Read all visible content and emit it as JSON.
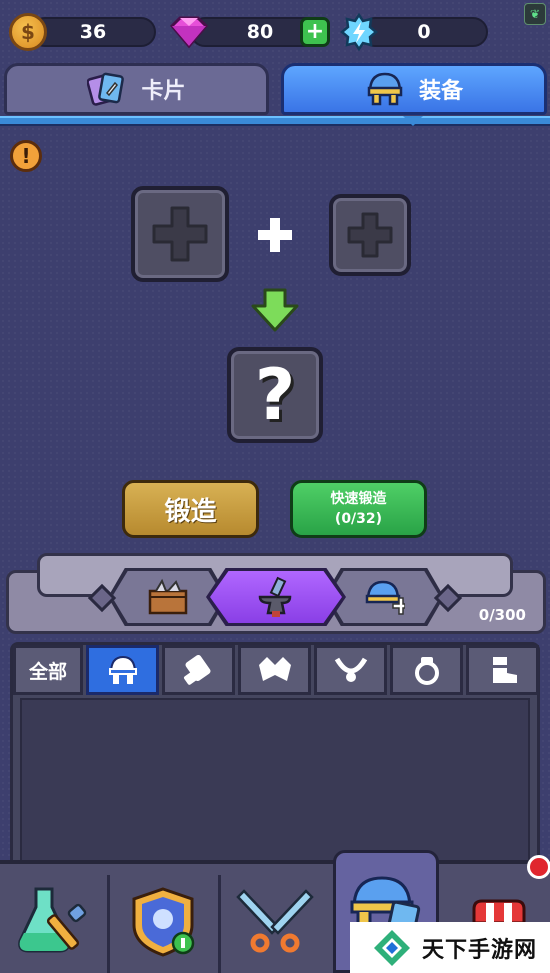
{
  "currency": {
    "gold": "36",
    "gems": "80",
    "energy": "0"
  },
  "tabs": [
    {
      "label": "卡片",
      "icon": "cards-icon"
    },
    {
      "label": "装备",
      "icon": "helmet-icon"
    }
  ],
  "forge": {
    "result_symbol": "?",
    "forge_button": "锻造",
    "quick_forge_button": "快速锻造",
    "quick_forge_count": "(0/32)"
  },
  "equipment_count": "0/300",
  "categories": [
    {
      "label": "全部"
    },
    {
      "icon": "helmet-icon"
    },
    {
      "icon": "gauntlet-icon"
    },
    {
      "icon": "armor-icon"
    },
    {
      "icon": "necklace-icon"
    },
    {
      "icon": "ring-icon"
    },
    {
      "icon": "boots-icon"
    }
  ],
  "bottom_nav": [
    {
      "icon": "potion-tools-icon"
    },
    {
      "icon": "hero-shield-icon"
    },
    {
      "icon": "crossed-swords-icon"
    },
    {
      "icon": "equipment-cards-icon"
    },
    {
      "icon": "shop-icon"
    }
  ],
  "watermark": "天下手游网",
  "colors": {
    "background": "#3d3f6e",
    "tab_active": "#3a74e6",
    "forge_button": "#c79c3f",
    "quick_forge_button": "#36b552",
    "category_active": "#2f6ee0"
  }
}
